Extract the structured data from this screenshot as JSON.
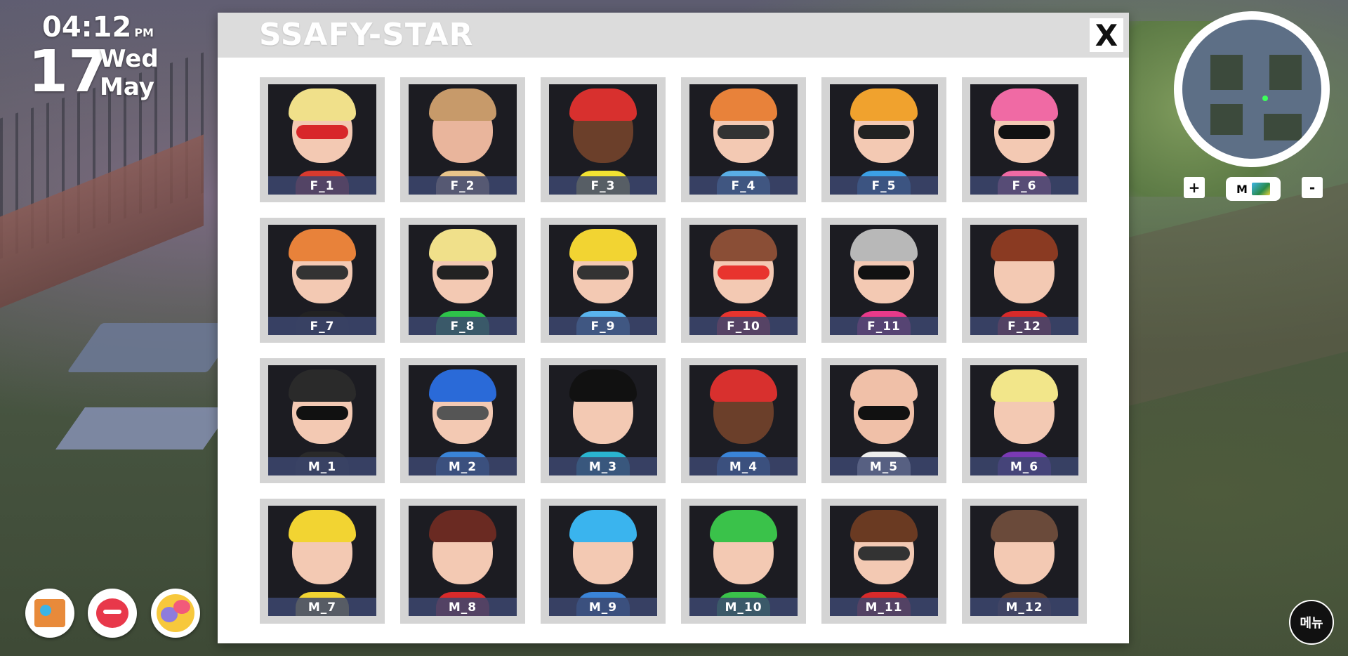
{
  "clock": {
    "time": "04:12",
    "ampm": "PM",
    "day": "17",
    "weekday": "Wed",
    "month": "May"
  },
  "dialog": {
    "title": "SSAFY-STAR",
    "close_label": "X"
  },
  "minimap": {
    "zoom_in": "+",
    "zoom_out": "-",
    "mode_label": "M"
  },
  "menu_label": "메뉴",
  "hud_icons": [
    "book-icon",
    "heart-icon",
    "chat-icon"
  ],
  "characters": [
    {
      "label": "F_1",
      "skin": "#f3c9b3",
      "hair": "#f0e08a",
      "shirt": "#d83a2e",
      "glasses": "#d8262a"
    },
    {
      "label": "F_2",
      "skin": "#e9b59c",
      "hair": "#c79a6a",
      "shirt": "#e8c48a",
      "glasses": ""
    },
    {
      "label": "F_3",
      "skin": "#6b3f2a",
      "hair": "#d8302e",
      "shirt": "#f2e232",
      "glasses": ""
    },
    {
      "label": "F_4",
      "skin": "#f3c9b3",
      "hair": "#e8823a",
      "shirt": "#5aaee6",
      "glasses": "#333333"
    },
    {
      "label": "F_5",
      "skin": "#f3c9b3",
      "hair": "#f0a22e",
      "shirt": "#3ca0e6",
      "glasses": "#222222"
    },
    {
      "label": "F_6",
      "skin": "#f3c9b3",
      "hair": "#f06aa4",
      "shirt": "#f06aa4",
      "glasses": "#111111"
    },
    {
      "label": "F_7",
      "skin": "#f3c9b3",
      "hair": "#e8823a",
      "shirt": "#222222",
      "glasses": "#333333"
    },
    {
      "label": "F_8",
      "skin": "#f3c9b3",
      "hair": "#f0e08a",
      "shirt": "#2ec24a",
      "glasses": "#222222"
    },
    {
      "label": "F_9",
      "skin": "#f3c9b3",
      "hair": "#f2d432",
      "shirt": "#5ab4ee",
      "glasses": "#333333"
    },
    {
      "label": "F_10",
      "skin": "#f3c9b3",
      "hair": "#8a4e36",
      "shirt": "#e8342e",
      "glasses": "#e8342e"
    },
    {
      "label": "F_11",
      "skin": "#f3c9b3",
      "hair": "#b8b8b8",
      "shirt": "#e83a8a",
      "glasses": "#111111"
    },
    {
      "label": "F_12",
      "skin": "#f3c9b3",
      "hair": "#8a3a22",
      "shirt": "#d82a2a",
      "glasses": ""
    },
    {
      "label": "M_1",
      "skin": "#f3c9b3",
      "hair": "#2a2a2a",
      "shirt": "#2a2a2a",
      "glasses": "#111111"
    },
    {
      "label": "M_2",
      "skin": "#f3c9b3",
      "hair": "#2a6ad8",
      "shirt": "#3a84d8",
      "glasses": "#555555"
    },
    {
      "label": "M_3",
      "skin": "#f3c9b3",
      "hair": "#111111",
      "shirt": "#2ab4d0",
      "glasses": ""
    },
    {
      "label": "M_4",
      "skin": "#6b3f2a",
      "hair": "#d8302e",
      "shirt": "#3a84d8",
      "glasses": ""
    },
    {
      "label": "M_5",
      "skin": "#f0c0a8",
      "hair": "#f0c0a8",
      "shirt": "#eeeeee",
      "glasses": "#111111"
    },
    {
      "label": "M_6",
      "skin": "#f3c9b3",
      "hair": "#f2e68a",
      "shirt": "#7a3ab4",
      "glasses": ""
    },
    {
      "label": "M_7",
      "skin": "#f3c9b3",
      "hair": "#f2d432",
      "shirt": "#f2d432",
      "glasses": ""
    },
    {
      "label": "M_8",
      "skin": "#f3c9b3",
      "hair": "#6a2a22",
      "shirt": "#d82a2a",
      "glasses": ""
    },
    {
      "label": "M_9",
      "skin": "#f3c9b3",
      "hair": "#3ab4ee",
      "shirt": "#3a84d8",
      "glasses": ""
    },
    {
      "label": "M_10",
      "skin": "#f3c9b3",
      "hair": "#3ac24a",
      "shirt": "#3ac24a",
      "glasses": ""
    },
    {
      "label": "M_11",
      "skin": "#f3c9b3",
      "hair": "#6a3a22",
      "shirt": "#d82a2a",
      "glasses": "#333333"
    },
    {
      "label": "M_12",
      "skin": "#f3c9b3",
      "hair": "#6a4a3a",
      "shirt": "#5a3a2a",
      "glasses": ""
    }
  ]
}
